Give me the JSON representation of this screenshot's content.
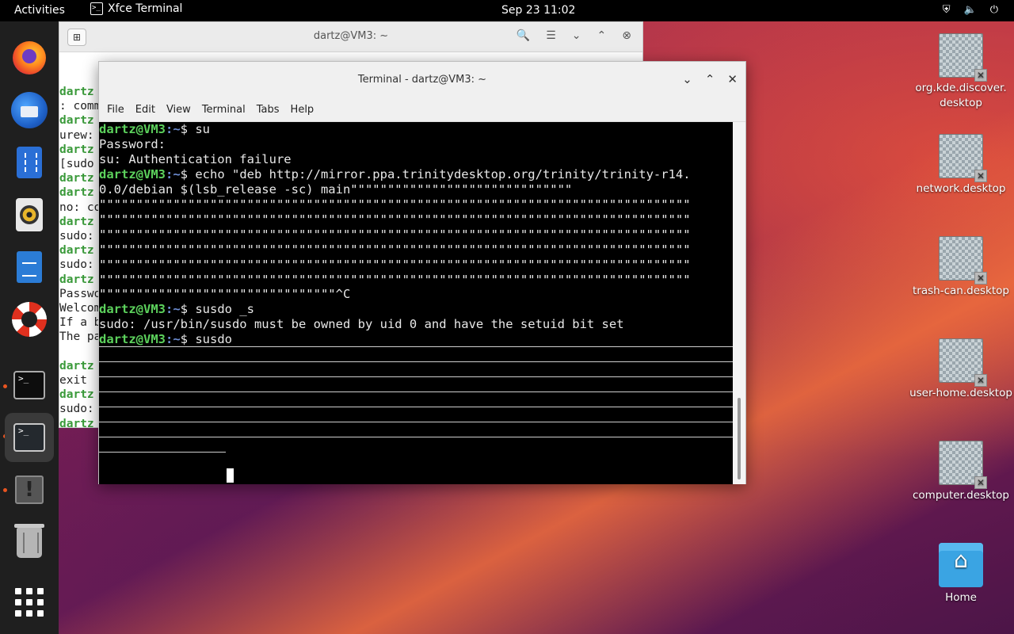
{
  "topbar": {
    "activities": "Activities",
    "app_name": "Xfce Terminal",
    "clock": "Sep 23  11:02",
    "tray": [
      "shield-icon",
      "speaker-icon",
      "power-icon"
    ]
  },
  "dock": {
    "items": [
      "firefox-icon",
      "thunderbird-icon",
      "files-icon",
      "rhythmbox-icon",
      "writer-icon",
      "help-icon",
      "terminal-icon",
      "terminal-icon",
      "warning-icon",
      "trash-icon",
      "apps-grid-icon"
    ]
  },
  "back_window": {
    "title": "dartz@VM3: ~",
    "lines": [
      "dartz",
      ": comm",
      "dartz",
      "urew:",
      "dartz",
      "[sudo",
      "dartz",
      "dartz",
      "no: co",
      "dartz",
      "sudo:",
      "dartz",
      "sudo:",
      "dartz",
      "Passwo",
      "Welcom",
      "If a b",
      "The pa",
      "",
      "dartz",
      "exit",
      "dartz",
      "sudo:",
      "dartz"
    ]
  },
  "terminal": {
    "title": "Terminal - dartz@VM3: ~",
    "menu": [
      "File",
      "Edit",
      "View",
      "Terminal",
      "Tabs",
      "Help"
    ],
    "prompt_user": "dartz@VM3",
    "prompt_path": ":~",
    "prompt_sym": "$ ",
    "cmd1": "su",
    "out1": "Password:",
    "out2": "su: Authentication failure",
    "cmd2": "echo \"deb http://mirror.ppa.trinitydesktop.org/trinity/trinity-r14.",
    "cont1": "0.0/debian $(lsb_release -sc) main\"\"\"\"\"\"\"\"\"\"\"\"\"\"\"\"\"\"\"\"\"\"\"\"\"\"\"\"\"\"",
    "quotes": "\"\"\"\"\"\"\"\"\"\"\"\"\"\"\"\"\"\"\"\"\"\"\"\"\"\"\"\"\"\"\"\"\"\"\"\"\"\"\"\"\"\"\"\"\"\"\"\"\"\"\"\"\"\"\"\"\"\"\"\"\"\"\"\"\"\"\"\"\"\"\"\"\"\"\"\"\"\"\"\"",
    "last_quotes": "\"\"\"\"\"\"\"\"\"\"\"\"\"\"\"\"\"\"\"\"\"\"\"\"\"\"\"\"\"\"\"\"^C",
    "cmd3": "susdo _s",
    "out3": "sudo: /usr/bin/susdo must be owned by uid 0 and have the setuid bit set",
    "cmd4": "susdo "
  },
  "desktop_icons": [
    {
      "label": "org.kde.discover.\ndesktop"
    },
    {
      "label": "network.desktop"
    },
    {
      "label": "trash-can.desktop"
    },
    {
      "label": "user-home.desktop"
    },
    {
      "label": "computer.desktop"
    },
    {
      "label": "Home"
    }
  ]
}
